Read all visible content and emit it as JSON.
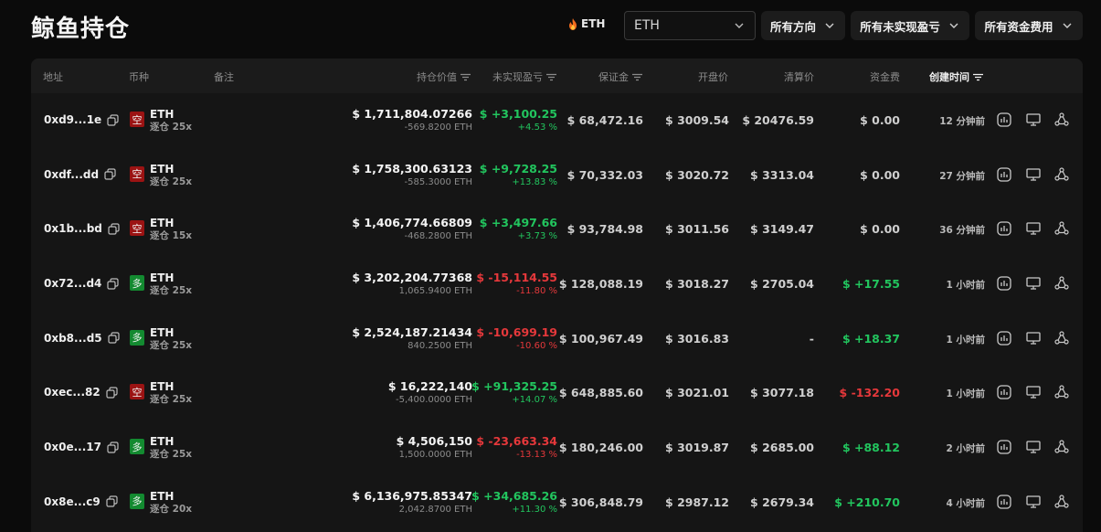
{
  "header": {
    "title": "鲸鱼持仓",
    "fire_label": "ETH",
    "coin_select": "ETH",
    "filter_direction": "所有方向",
    "filter_pnl": "所有未实现盈亏",
    "filter_funding": "所有资金费用"
  },
  "columns": {
    "address": "地址",
    "coin": "币种",
    "note": "备注",
    "value": "持仓价值",
    "pnl": "未实现盈亏",
    "margin": "保证金",
    "entry": "开盘价",
    "liq": "清算价",
    "funding": "资金费",
    "created": "创建时间"
  },
  "colors": {
    "positive": "#22c55e",
    "negative": "#e5383b",
    "short_badge": "#9b1313",
    "long_badge": "#138a30"
  },
  "rows": [
    {
      "address": "0xd9...1e",
      "side": "空",
      "side_type": "short",
      "coin": "ETH",
      "leverage": "逐仓 25x",
      "value": "$ 1,711,804.07266",
      "size": "-569.8200 ETH",
      "pnl": "$ +3,100.25",
      "pnl_pct": "+4.53 %",
      "pnl_sign": "pos",
      "margin": "$ 68,472.16",
      "entry": "$ 3009.54",
      "liq": "$ 20476.59",
      "funding": "$ 0.00",
      "funding_sign": "neutral",
      "created": "12 分钟前"
    },
    {
      "address": "0xdf...dd",
      "side": "空",
      "side_type": "short",
      "coin": "ETH",
      "leverage": "逐仓 25x",
      "value": "$ 1,758,300.63123",
      "size": "-585.3000 ETH",
      "pnl": "$ +9,728.25",
      "pnl_pct": "+13.83 %",
      "pnl_sign": "pos",
      "margin": "$ 70,332.03",
      "entry": "$ 3020.72",
      "liq": "$ 3313.04",
      "funding": "$ 0.00",
      "funding_sign": "neutral",
      "created": "27 分钟前"
    },
    {
      "address": "0x1b...bd",
      "side": "空",
      "side_type": "short",
      "coin": "ETH",
      "leverage": "逐仓 15x",
      "value": "$ 1,406,774.66809",
      "size": "-468.2800 ETH",
      "pnl": "$ +3,497.66",
      "pnl_pct": "+3.73 %",
      "pnl_sign": "pos",
      "margin": "$ 93,784.98",
      "entry": "$ 3011.56",
      "liq": "$ 3149.47",
      "funding": "$ 0.00",
      "funding_sign": "neutral",
      "created": "36 分钟前"
    },
    {
      "address": "0x72...d4",
      "side": "多",
      "side_type": "long",
      "coin": "ETH",
      "leverage": "逐仓 25x",
      "value": "$ 3,202,204.77368",
      "size": "1,065.9400 ETH",
      "pnl": "$ -15,114.55",
      "pnl_pct": "-11.80 %",
      "pnl_sign": "neg",
      "margin": "$ 128,088.19",
      "entry": "$ 3018.27",
      "liq": "$ 2705.04",
      "funding": "$ +17.55",
      "funding_sign": "pos",
      "created": "1 小时前"
    },
    {
      "address": "0xb8...d5",
      "side": "多",
      "side_type": "long",
      "coin": "ETH",
      "leverage": "逐仓 25x",
      "value": "$ 2,524,187.21434",
      "size": "840.2500 ETH",
      "pnl": "$ -10,699.19",
      "pnl_pct": "-10.60 %",
      "pnl_sign": "neg",
      "margin": "$ 100,967.49",
      "entry": "$ 3016.83",
      "liq": "-",
      "funding": "$ +18.37",
      "funding_sign": "pos",
      "created": "1 小时前"
    },
    {
      "address": "0xec...82",
      "side": "空",
      "side_type": "short",
      "coin": "ETH",
      "leverage": "逐仓 25x",
      "value": "$ 16,222,140",
      "size": "-5,400.0000 ETH",
      "pnl": "$ +91,325.25",
      "pnl_pct": "+14.07 %",
      "pnl_sign": "pos",
      "margin": "$ 648,885.60",
      "entry": "$ 3021.01",
      "liq": "$ 3077.18",
      "funding": "$ -132.20",
      "funding_sign": "neg",
      "created": "1 小时前"
    },
    {
      "address": "0x0e...17",
      "side": "多",
      "side_type": "long",
      "coin": "ETH",
      "leverage": "逐仓 25x",
      "value": "$ 4,506,150",
      "size": "1,500.0000 ETH",
      "pnl": "$ -23,663.34",
      "pnl_pct": "-13.13 %",
      "pnl_sign": "neg",
      "margin": "$ 180,246.00",
      "entry": "$ 3019.87",
      "liq": "$ 2685.00",
      "funding": "$ +88.12",
      "funding_sign": "pos",
      "created": "2 小时前"
    },
    {
      "address": "0x8e...c9",
      "side": "多",
      "side_type": "long",
      "coin": "ETH",
      "leverage": "逐仓 20x",
      "value": "$ 6,136,975.85347",
      "size": "2,042.8700 ETH",
      "pnl": "$ +34,685.26",
      "pnl_pct": "+11.30 %",
      "pnl_sign": "pos",
      "margin": "$ 306,848.79",
      "entry": "$ 2987.12",
      "liq": "$ 2679.34",
      "funding": "$ +210.70",
      "funding_sign": "pos",
      "created": "4 小时前"
    }
  ]
}
